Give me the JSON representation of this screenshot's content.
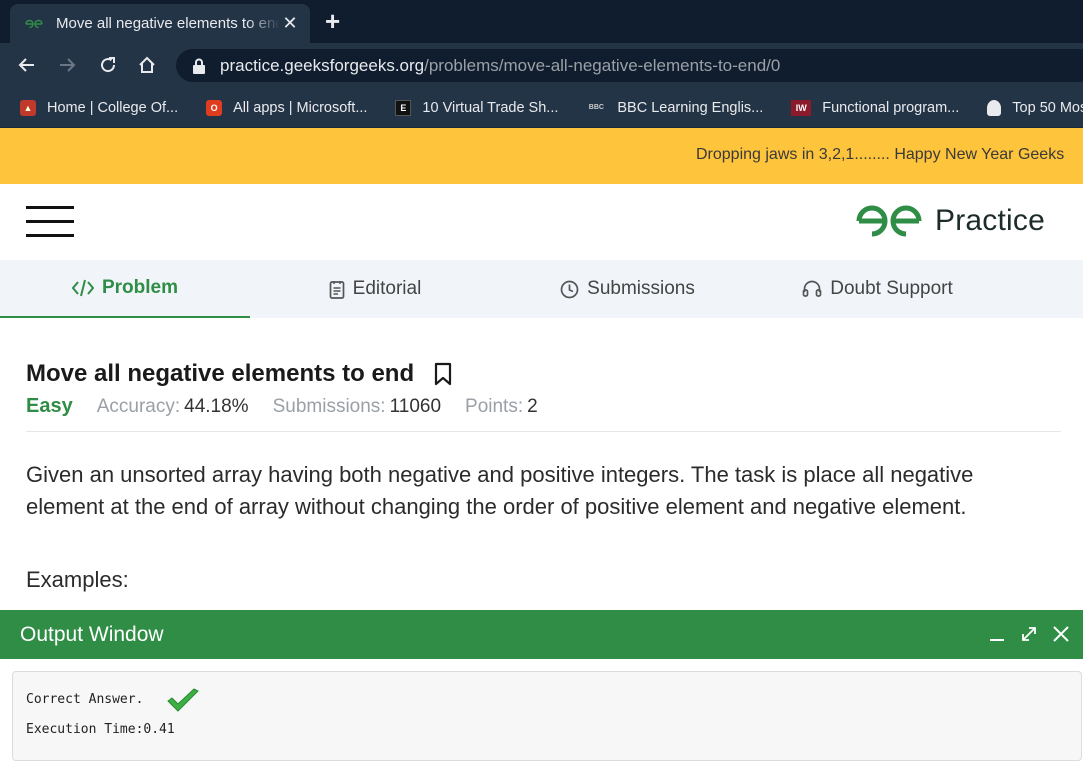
{
  "browser": {
    "tab": {
      "title": "Move all negative elements to end"
    },
    "address_bar": {
      "domain": "practice.geeksforgeeks.org",
      "path": "/problems/move-all-negative-elements-to-end/0"
    },
    "bookmarks": [
      {
        "label": "Home | College Of...",
        "icon": "college-icon"
      },
      {
        "label": "All apps | Microsoft...",
        "icon": "office-icon"
      },
      {
        "label": "10 Virtual Trade Sh...",
        "icon": "ef-icon"
      },
      {
        "label": "BBC Learning Englis...",
        "icon": "bbc-icon"
      },
      {
        "label": "Functional program...",
        "icon": "iw-icon"
      },
      {
        "label": "Top 50 Mos",
        "icon": "ghost-icon"
      }
    ]
  },
  "banner": {
    "text": "Dropping jaws in 3,2,1........ Happy New Year Geeks"
  },
  "header": {
    "logo_text": "Practice"
  },
  "tabs": [
    {
      "label": "Problem",
      "icon": "code-icon",
      "active": true
    },
    {
      "label": "Editorial",
      "icon": "document-icon",
      "active": false
    },
    {
      "label": "Submissions",
      "icon": "clock-icon",
      "active": false
    },
    {
      "label": "Doubt Support",
      "icon": "headset-icon",
      "active": false
    }
  ],
  "problem": {
    "title": "Move all negative elements to end",
    "difficulty": "Easy",
    "accuracy_label": "Accuracy:",
    "accuracy": "44.18%",
    "submissions_label": "Submissions:",
    "submissions": "11060",
    "points_label": "Points:",
    "points": "2",
    "description": "Given an unsorted array having both negative and positive integers. The task is place all negative element at the end of array without changing the order of positive element and negative element.",
    "examples_label": "Examples:"
  },
  "output": {
    "title": "Output Window",
    "result": "Correct Answer.",
    "execution_time": "Execution Time:0.41"
  },
  "colors": {
    "brand_green": "#2f8d46",
    "banner_yellow": "#fec43b",
    "chrome_dark": "#0f1d2e",
    "chrome_toolbar": "#243447"
  }
}
